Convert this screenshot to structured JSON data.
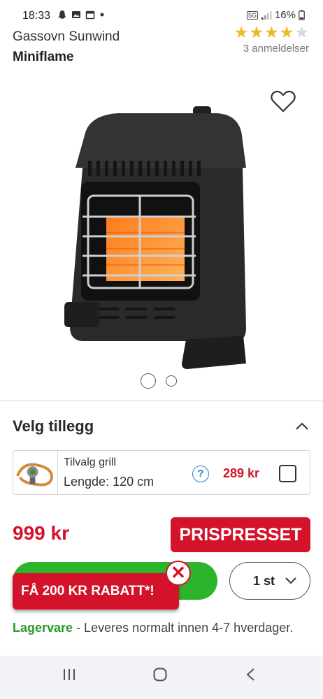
{
  "status_bar": {
    "time": "18:33",
    "network": "5G",
    "battery": "16%",
    "left_icons": [
      "snapchat-ghost-icon",
      "gallery-icon",
      "calendar-icon",
      "notification-dot-icon"
    ]
  },
  "product": {
    "brand_line": "Gassovn Sunwind",
    "model_line": "Miniflame",
    "rating": 4,
    "rating_max": 5,
    "review_count": "3 anmeldelser",
    "image_count": 2,
    "active_image": 1
  },
  "addons": {
    "title": "Velg tillegg",
    "items": [
      {
        "name": "Tilvalg grill",
        "length": "Lengde: 120 cm",
        "help": "?",
        "price": "289 kr",
        "checked": false
      }
    ]
  },
  "price": {
    "value": "999 kr",
    "badge": "PRISPRESSET"
  },
  "buy": {
    "promo": "FÅ 200 KR RABATT*!",
    "close_symbol": "✕",
    "quantity": "1 st"
  },
  "stock": {
    "status": "Lagervare",
    "note": " - Leveres normalt innen 4-7 hverdager."
  },
  "colors": {
    "accent_red": "#d3132a",
    "buy_green": "#2cb52c",
    "stock_green": "#2a9a2a",
    "star_gold": "#f2b820"
  }
}
